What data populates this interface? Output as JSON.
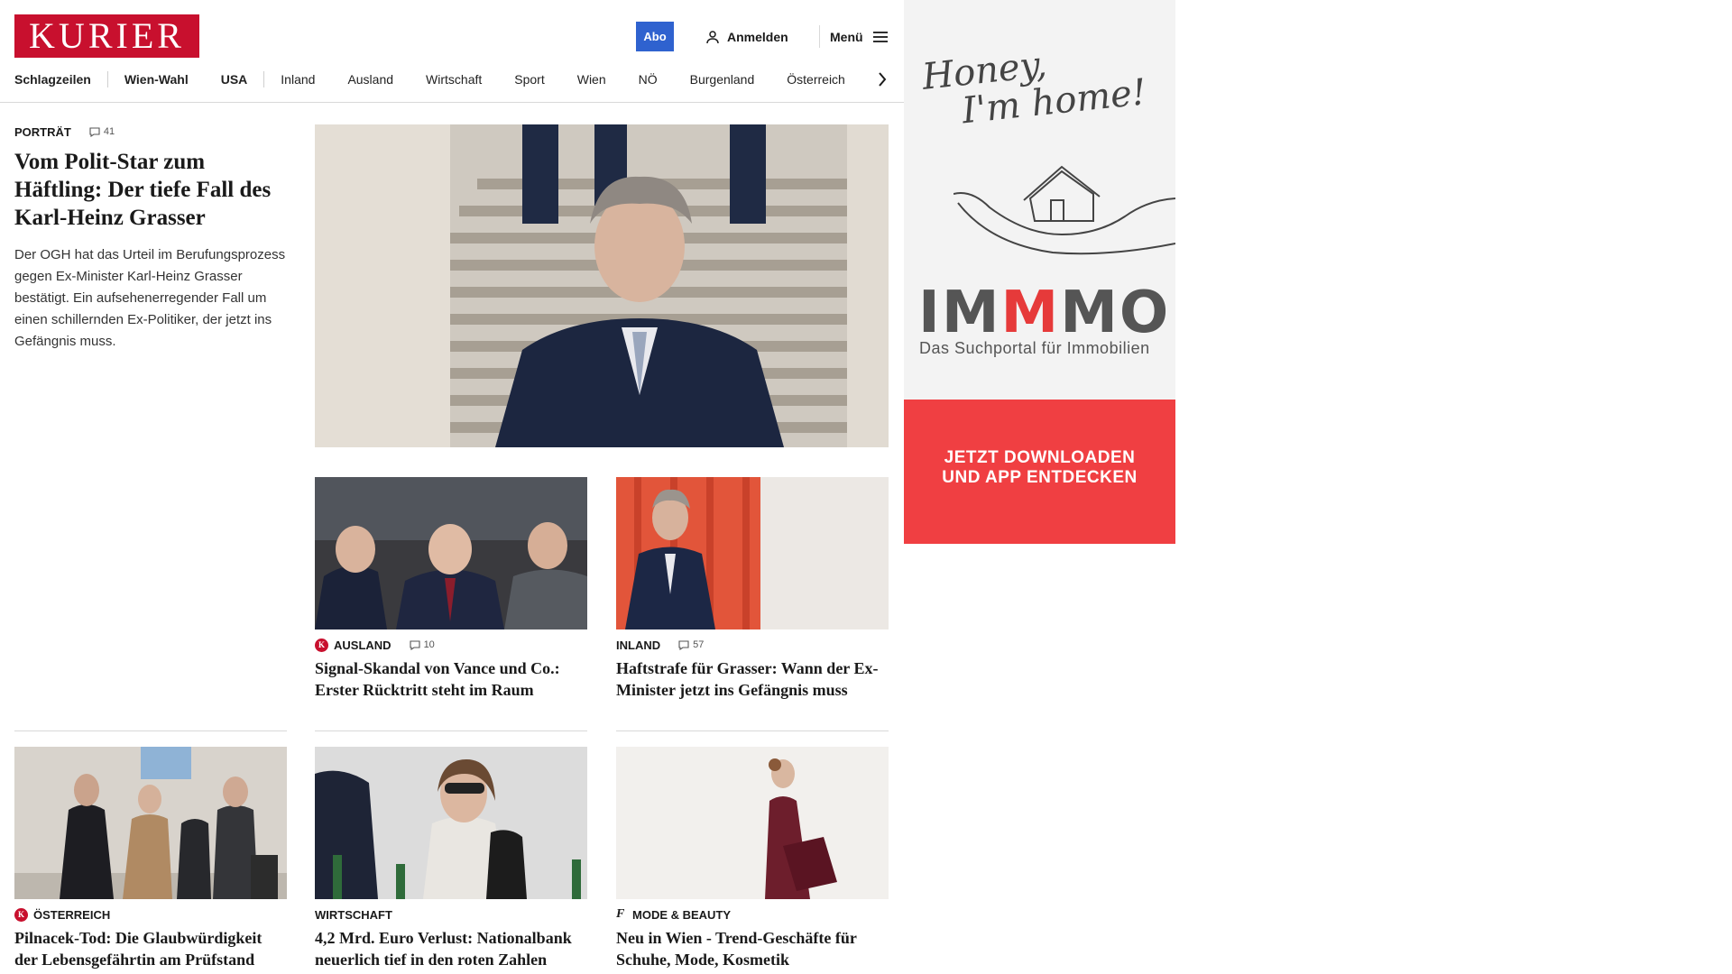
{
  "header": {
    "logo": "KURIER",
    "abo_label": "Abo",
    "login_label": "Anmelden",
    "menu_label": "Menü"
  },
  "nav": {
    "items": [
      "Schlagzeilen",
      "Wien-Wahl",
      "USA",
      "Inland",
      "Ausland",
      "Wirtschaft",
      "Sport",
      "Wien",
      "NÖ",
      "Burgenland",
      "Österreich"
    ]
  },
  "lead": {
    "kicker": "PORTRÄT",
    "comments": "41",
    "headline": "Vom Polit-Star zum Häftling: Der tiefe Fall des Karl-Heinz Grasser",
    "teaser": "Der OGH hat das Urteil im Berufungsprozess gegen Ex-Minister Karl-Heinz Grasser bestätigt. Ein aufsehenerregender Fall um einen schillernden Ex-Politiker, der jetzt ins Gefängnis muss."
  },
  "cards": [
    {
      "kicker": "AUSLAND",
      "comments": "10",
      "headline": "Signal-Skandal von Vance und Co.: Erster Rücktritt steht im Raum"
    },
    {
      "kicker": "INLAND",
      "comments": "57",
      "headline": "Haftstrafe für Grasser: Wann der Ex-Minister jetzt ins Gefängnis muss"
    },
    {
      "kicker": "ÖSTERREICH",
      "headline": "Pilnacek-Tod: Die Glaubwürdigkeit der Lebensgefährtin am Prüfstand"
    },
    {
      "kicker": "WIRTSCHAFT",
      "headline": "4,2 Mrd. Euro Verlust: Nationalbank neuerlich tief in den roten Zahlen"
    },
    {
      "kicker": "MODE & BEAUTY",
      "headline": "Neu in Wien - Trend-Geschäfte für Schuhe, Mode, Kosmetik"
    }
  ],
  "ad": {
    "script_line1": "Honey,",
    "script_line2": "I'm home!",
    "brand_part1": "IM",
    "brand_part2": "M",
    "brand_part3": "MO",
    "subline": "Das Suchportal für Immobilien",
    "cta_line1": "JETZT DOWNLOADEN",
    "cta_line2": "UND APP ENTDECKEN"
  },
  "colors": {
    "brand_red": "#c8102e",
    "abo_blue": "#2f62cf",
    "ad_red": "#f03f42"
  }
}
